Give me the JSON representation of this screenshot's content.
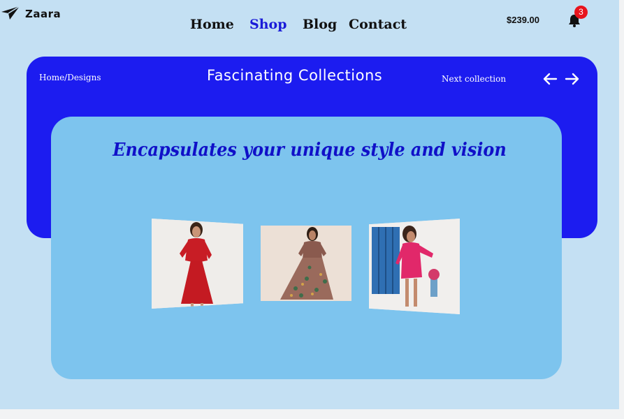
{
  "brand": {
    "name": "Zaara",
    "logo_icon": "paper-plane-icon"
  },
  "nav": {
    "items": [
      {
        "label": "Home",
        "active": false
      },
      {
        "label": "Shop",
        "active": true
      },
      {
        "label": "Blog",
        "active": false
      },
      {
        "label": "Contact",
        "active": false
      }
    ]
  },
  "cart": {
    "total": "$239.00"
  },
  "notifications": {
    "icon": "bell-icon",
    "count": "3"
  },
  "hero": {
    "breadcrumb": "Home/Designs",
    "title": "Fascinating Collections",
    "next_label": "Next collection",
    "prev_icon": "arrow-left-icon",
    "next_icon": "arrow-right-icon"
  },
  "collection": {
    "tagline": "Encapsulates your unique style and vision",
    "items": [
      {
        "name": "red-dress-photo"
      },
      {
        "name": "floral-maxi-dress-photo"
      },
      {
        "name": "pink-wrap-dress-photo"
      }
    ]
  },
  "colors": {
    "page_bg": "#c4e0f3",
    "hero_bg": "#1c1cf0",
    "card_bg": "#7dc4ee",
    "accent": "#1a1ad8",
    "badge": "#e8141d"
  }
}
